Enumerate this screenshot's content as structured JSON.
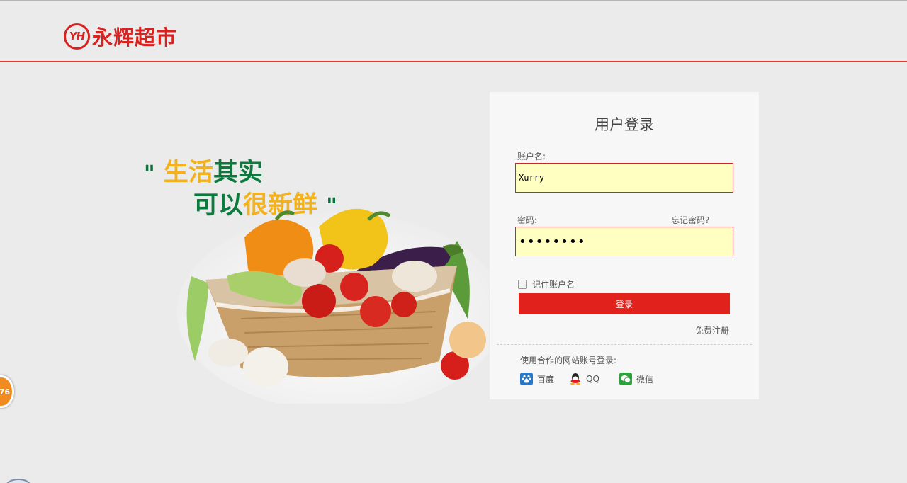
{
  "header": {
    "logo_mark": "YH",
    "logo_text": "永辉超市"
  },
  "slogan": {
    "quote_open": "\"",
    "line1_yellow": "生活",
    "line1_green": "其实",
    "line2_green": "可以",
    "line2_yellow": "很新鲜",
    "quote_close": "\""
  },
  "login": {
    "title": "用户登录",
    "username_label": "账户名:",
    "username_value": "Xurry",
    "password_label": "密码:",
    "forgot_label": "忘记密码?",
    "password_value": "••••••••",
    "remember_label": "记住账户名",
    "remember_checked": false,
    "submit_label": "登录",
    "register_label": "免费注册",
    "third_party_label": "使用合作的网站账号登录:",
    "third_party": [
      {
        "name": "百度",
        "icon": "baidu-icon"
      },
      {
        "name": "QQ",
        "icon": "qq-penguin-icon"
      },
      {
        "name": "微信",
        "icon": "wechat-icon"
      }
    ]
  },
  "side_badge": {
    "value": "76"
  },
  "colors": {
    "brand_red": "#d9211f",
    "button_red": "#e0211c",
    "input_bg": "#ffffc2",
    "slogan_yellow": "#f3b21b",
    "slogan_green": "#0b7a3d"
  }
}
